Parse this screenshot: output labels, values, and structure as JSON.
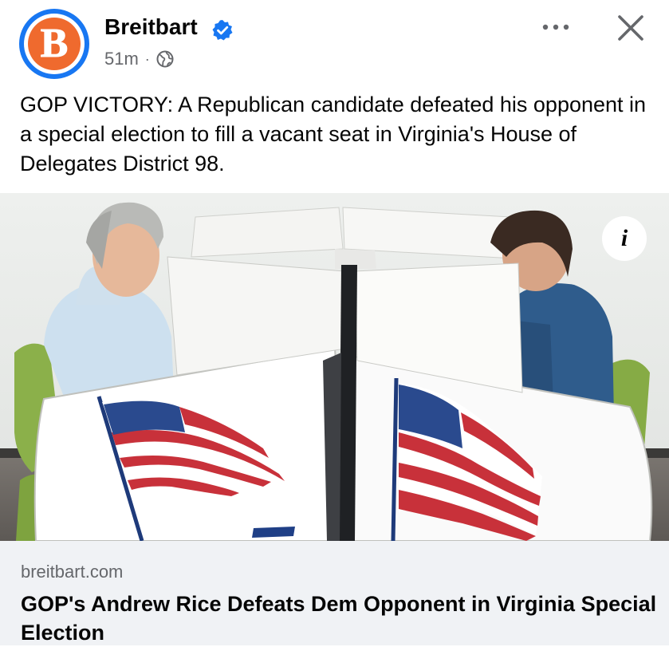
{
  "post": {
    "page_name": "Breitbart",
    "avatar_letter": "B",
    "time_ago": "51m",
    "separator": "·",
    "text": "GOP VICTORY: A Republican candidate defeated his opponent in a special election to fill a vacant seat in Virginia's House of Delegates District 98.",
    "info_button": "i"
  },
  "link_preview": {
    "domain": "breitbart.com",
    "title": "GOP's Andrew Rice Defeats Dem Opponent in Virginia Special Election"
  },
  "icons": {
    "verified": "verified-badge-icon",
    "privacy": "globe-icon",
    "more": "more-options-icon",
    "close": "close-icon"
  },
  "colors": {
    "brand_blue": "#1877f2",
    "avatar_orange": "#ef6a2e",
    "secondary_text": "#65676b",
    "link_card_bg": "#f0f2f5"
  }
}
